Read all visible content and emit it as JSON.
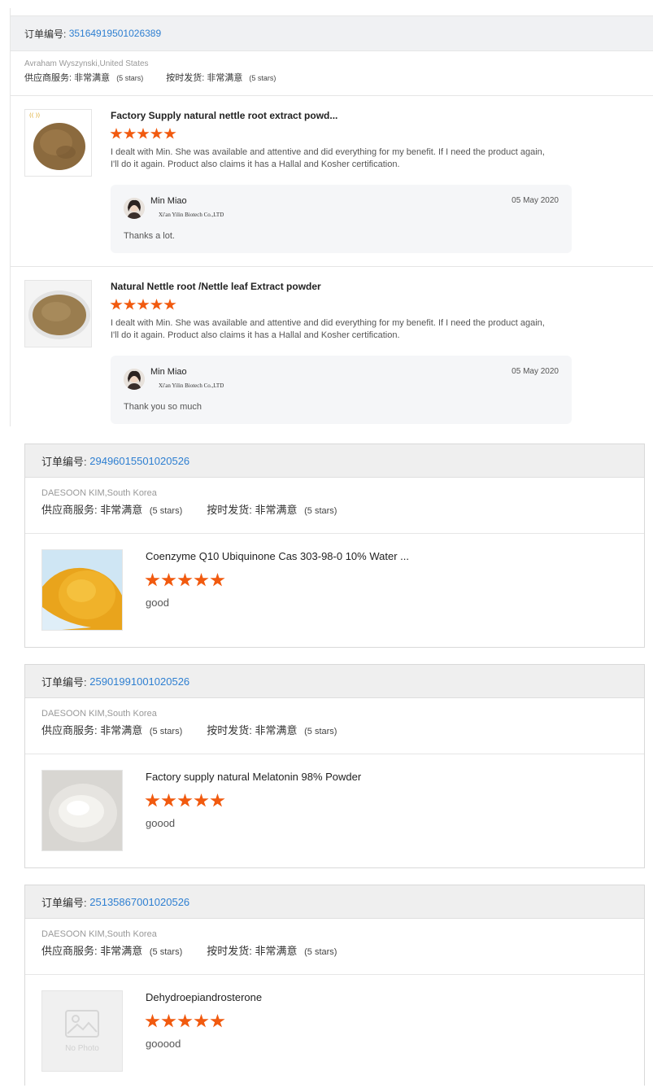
{
  "labels": {
    "order_prefix": "订单编号:",
    "supplier_service": "供应商服务:",
    "on_time_delivery": "按时发货:",
    "very_satisfied": "非常满意",
    "five_stars": "(5 stars)"
  },
  "top_order": {
    "order_number": "35164919501026389",
    "buyer": "Avraham Wyszynski,United States",
    "items": [
      {
        "title": "Factory Supply natural nettle root extract powd...",
        "rating": 5,
        "comment": "I dealt with Min. She was available and attentive and did everything for my benefit. If I need the product again, I'll do it again. Product also claims it has a Hallal and Kosher certification.",
        "reply": {
          "seller_name": "Min Miao",
          "company": "Xi'an Yilin Biotech Co.,LTD",
          "date": "05 May 2020",
          "text": "Thanks a lot."
        }
      },
      {
        "title": "Natural Nettle root /Nettle leaf Extract powder",
        "rating": 5,
        "comment": "I dealt with Min. She was available and attentive and did everything for my benefit. If I need the product again, I'll do it again. Product also claims it has a Hallal and Kosher certification.",
        "reply": {
          "seller_name": "Min Miao",
          "company": "Xi'an Yilin Biotech Co.,LTD",
          "date": "05 May 2020",
          "text": "Thank you so much"
        }
      }
    ]
  },
  "orders": [
    {
      "order_number": "29496015501020526",
      "buyer": "DAESOON KIM,South Korea",
      "item": {
        "title": "Coenzyme Q10 Ubiquinone Cas 303-98-0 10% Water ...",
        "rating": 5,
        "comment": "good",
        "image": "orange-powder"
      }
    },
    {
      "order_number": "25901991001020526",
      "buyer": "DAESOON KIM,South Korea",
      "item": {
        "title": "Factory supply natural Melatonin 98% Powder",
        "rating": 5,
        "comment": "goood",
        "image": "white-powder"
      }
    },
    {
      "order_number": "25135867001020526",
      "buyer": "DAESOON KIM,South Korea",
      "item": {
        "title": "Dehydroepiandrosterone",
        "rating": 5,
        "comment": "gooood",
        "image": "no-photo",
        "no_photo_text": "No Photo"
      }
    }
  ],
  "colors": {
    "star": "#f15a0f",
    "order_number": "#2e7fd1",
    "header_bg": "#efefef"
  }
}
